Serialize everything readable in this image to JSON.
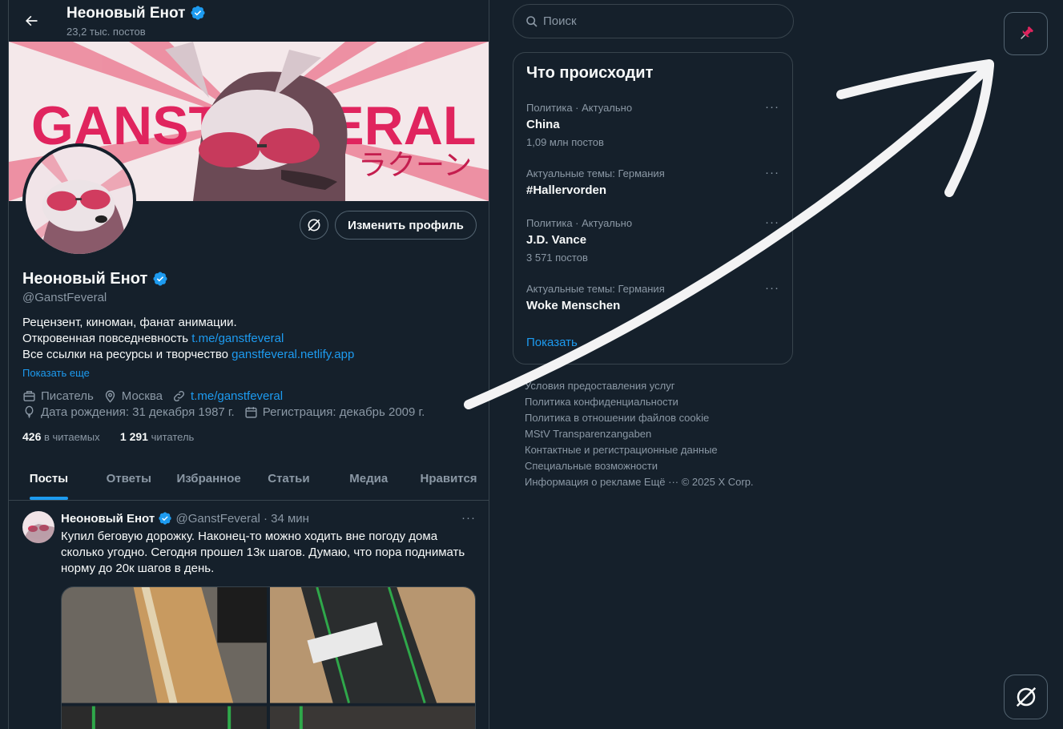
{
  "header": {
    "name": "Неоновый Енот",
    "posts_count": "23,2 тыс. постов"
  },
  "banner": {
    "text_big": "GANSTFEVERAL",
    "text_jp": "ラクーン"
  },
  "profile": {
    "grok_button": "grok-icon",
    "edit_button": "Изменить профиль",
    "name": "Неоновый Енот",
    "handle": "@GanstFeveral",
    "bio": [
      {
        "text": "Рецензент, киноман, фанат анимации.",
        "link": ""
      },
      {
        "text": "Откровенная повседневность ",
        "link": "t.me/ganstfeveral"
      },
      {
        "text": "Все ссылки на ресурсы и творчество ",
        "link": "ganstfeveral.netlify.app"
      }
    ],
    "show_more": "Показать еще",
    "profession": "Писатель",
    "location": "Москва",
    "website": "t.me/ganstfeveral",
    "birthday": "Дата рождения: 31 декабря 1987 г.",
    "joined": "Регистрация: декабрь 2009 г.",
    "following_count": "426",
    "following_label": "в читаемых",
    "followers_count": "1 291",
    "followers_label": "читатель"
  },
  "tabs": [
    "Посты",
    "Ответы",
    "Избранное",
    "Статьи",
    "Медиа",
    "Нравится"
  ],
  "post": {
    "author": "Неоновый Енот",
    "handle": "@GanstFeveral",
    "time": "· 34 мин",
    "more": "···",
    "lines": [
      "Купил беговую дорожку. Наконец-то можно ходить вне погоду дома",
      "сколько угодно. Сегодня прошел 13к шагов. Думаю, что пора поднимать",
      "норму до 20к шагов в день."
    ]
  },
  "search": {
    "placeholder": "Поиск"
  },
  "trends": {
    "title": "Что происходит",
    "items": [
      {
        "meta": "Политика · Актуально",
        "name": "China",
        "count": "1,09 млн постов"
      },
      {
        "meta": "Актуальные темы: Германия",
        "name": "#Hallervorden",
        "count": ""
      },
      {
        "meta": "Политика · Актуально",
        "name": "J.D. Vance",
        "count": "3 571 постов"
      },
      {
        "meta": "Актуальные темы: Германия",
        "name": "Woke Menschen",
        "count": ""
      }
    ],
    "dots": "···",
    "show_more": "Показать"
  },
  "footer": [
    "Условия предоставления услуг",
    "Политика конфиденциальности",
    "Политика в отношении файлов cookie",
    "MStV Transparenzangaben",
    "Контактные и регистрационные данные",
    "Специальные возможности",
    "Информация о рекламе  Ещё ···    © 2025 X Corp."
  ],
  "floating": {
    "pin_icon": "pushpin-icon",
    "grok_icon": "grok-icon"
  },
  "colors": {
    "background": "#15202b",
    "accent": "#1d9bf0",
    "muted": "#8b98a5",
    "border": "#38444d",
    "banner_pink": "#e0245e"
  }
}
